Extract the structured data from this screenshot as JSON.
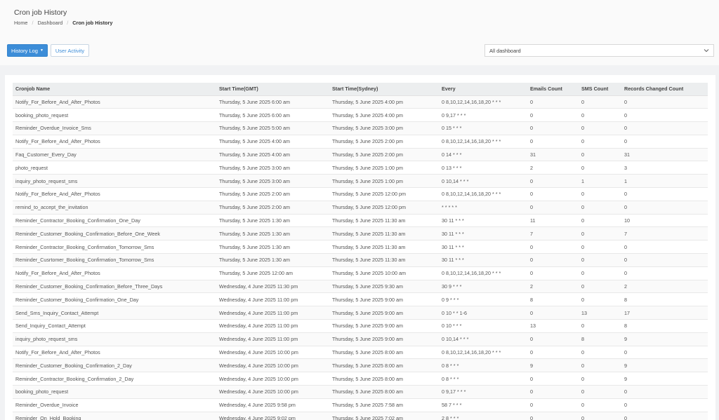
{
  "header": {
    "title": "Cron job History",
    "breadcrumb": [
      "Home",
      "Dashboard",
      "Cron job History"
    ]
  },
  "toolbar": {
    "history_log_label": "History Log",
    "user_activity_label": "User Activity",
    "dashboard_select_value": "All dashboard"
  },
  "colors": {
    "primary": "#3c8dd8"
  },
  "table": {
    "columns": [
      "Cronjob Name",
      "Start Time(GMT)",
      "Start Time(Sydney)",
      "Every",
      "Emails Count",
      "SMS Count",
      "Records Changed Count"
    ],
    "rows": [
      [
        "Notify_For_Before_And_After_Photos",
        "Thursday, 5 June 2025 6:00 am",
        "Thursday, 5 June 2025 4:00 pm",
        "0 8,10,12,14,16,18,20 * * *",
        "0",
        "0",
        "0"
      ],
      [
        "booking_photo_request",
        "Thursday, 5 June 2025 6:00 am",
        "Thursday, 5 June 2025 4:00 pm",
        "0 9,17 * * *",
        "0",
        "0",
        "0"
      ],
      [
        "Reminder_Overdue_Invoice_Sms",
        "Thursday, 5 June 2025 5:00 am",
        "Thursday, 5 June 2025 3:00 pm",
        "0 15 * * *",
        "0",
        "0",
        "0"
      ],
      [
        "Notify_For_Before_And_After_Photos",
        "Thursday, 5 June 2025 4:00 am",
        "Thursday, 5 June 2025 2:00 pm",
        "0 8,10,12,14,16,18,20 * * *",
        "0",
        "0",
        "0"
      ],
      [
        "Faq_Customer_Every_Day",
        "Thursday, 5 June 2025 4:00 am",
        "Thursday, 5 June 2025 2:00 pm",
        "0 14 * * *",
        "31",
        "0",
        "31"
      ],
      [
        "photo_request",
        "Thursday, 5 June 2025 3:00 am",
        "Thursday, 5 June 2025 1:00 pm",
        "0 13 * * *",
        "2",
        "0",
        "3"
      ],
      [
        "inquiry_photo_request_sms",
        "Thursday, 5 June 2025 3:00 am",
        "Thursday, 5 June 2025 1:00 pm",
        "0 10,14 * * *",
        "0",
        "1",
        "1"
      ],
      [
        "Notify_For_Before_And_After_Photos",
        "Thursday, 5 June 2025 2:00 am",
        "Thursday, 5 June 2025 12:00 pm",
        "0 8,10,12,14,16,18,20 * * *",
        "0",
        "0",
        "0"
      ],
      [
        "remind_to_accept_the_invitation",
        "Thursday, 5 June 2025 2:00 am",
        "Thursday, 5 June 2025 12:00 pm",
        "* * * * *",
        "0",
        "0",
        "0"
      ],
      [
        "Reminder_Contractor_Booking_Confirmation_One_Day",
        "Thursday, 5 June 2025 1:30 am",
        "Thursday, 5 June 2025 11:30 am",
        "30 11 * * *",
        "11",
        "0",
        "10"
      ],
      [
        "Reminder_Customer_Booking_Confirmation_Before_One_Week",
        "Thursday, 5 June 2025 1:30 am",
        "Thursday, 5 June 2025 11:30 am",
        "30 11 * * *",
        "7",
        "0",
        "7"
      ],
      [
        "Reminder_Contractor_Booking_Confirmation_Tomorrow_Sms",
        "Thursday, 5 June 2025 1:30 am",
        "Thursday, 5 June 2025 11:30 am",
        "30 11 * * *",
        "0",
        "0",
        "0"
      ],
      [
        "Reminder_Cusrtomer_Booking_Confirmation_Tomorrow_Sms",
        "Thursday, 5 June 2025 1:30 am",
        "Thursday, 5 June 2025 11:30 am",
        "30 11 * * *",
        "0",
        "0",
        "0"
      ],
      [
        "Notify_For_Before_And_After_Photos",
        "Thursday, 5 June 2025 12:00 am",
        "Thursday, 5 June 2025 10:00 am",
        "0 8,10,12,14,16,18,20 * * *",
        "0",
        "0",
        "0"
      ],
      [
        "Reminder_Customer_Booking_Confirmation_Before_Three_Days",
        "Wednesday, 4 June 2025 11:30 pm",
        "Thursday, 5 June 2025 9:30 am",
        "30 9 * * *",
        "2",
        "0",
        "2"
      ],
      [
        "Reminder_Customer_Booking_Confirmation_One_Day",
        "Wednesday, 4 June 2025 11:00 pm",
        "Thursday, 5 June 2025 9:00 am",
        "0 9 * * *",
        "8",
        "0",
        "8"
      ],
      [
        "Send_Sms_Inquiry_Contact_Attempt",
        "Wednesday, 4 June 2025 11:00 pm",
        "Thursday, 5 June 2025 9:00 am",
        "0 10 * * 1-6",
        "0",
        "13",
        "17"
      ],
      [
        "Send_Inquiry_Contact_Attempt",
        "Wednesday, 4 June 2025 11:00 pm",
        "Thursday, 5 June 2025 9:00 am",
        "0 10 * * *",
        "13",
        "0",
        "8"
      ],
      [
        "inquiry_photo_request_sms",
        "Wednesday, 4 June 2025 11:00 pm",
        "Thursday, 5 June 2025 9:00 am",
        "0 10,14 * * *",
        "0",
        "8",
        "9"
      ],
      [
        "Notify_For_Before_And_After_Photos",
        "Wednesday, 4 June 2025 10:00 pm",
        "Thursday, 5 June 2025 8:00 am",
        "0 8,10,12,14,16,18,20 * * *",
        "0",
        "0",
        "0"
      ],
      [
        "Reminder_Customer_Booking_Confirmation_2_Day",
        "Wednesday, 4 June 2025 10:00 pm",
        "Thursday, 5 June 2025 8:00 am",
        "0 8 * * *",
        "9",
        "0",
        "9"
      ],
      [
        "Reminder_Contractor_Booking_Confirmation_2_Day",
        "Wednesday, 4 June 2025 10:00 pm",
        "Thursday, 5 June 2025 8:00 am",
        "0 8 * * *",
        "0",
        "0",
        "9"
      ],
      [
        "booking_photo_request",
        "Wednesday, 4 June 2025 10:00 pm",
        "Thursday, 5 June 2025 8:00 am",
        "0 9,17 * * *",
        "0",
        "0",
        "0"
      ],
      [
        "Reminder_Overdue_Invoice",
        "Wednesday, 4 June 2025 9:58 pm",
        "Thursday, 5 June 2025 7:58 am",
        "58 7 * * *",
        "0",
        "0",
        "0"
      ],
      [
        "Reminder_On_Hold_Booking",
        "Wednesday, 4 June 2025 9:02 pm",
        "Thursday, 5 June 2025 7:02 am",
        "2 8 * * *",
        "0",
        "0",
        "0"
      ]
    ]
  }
}
